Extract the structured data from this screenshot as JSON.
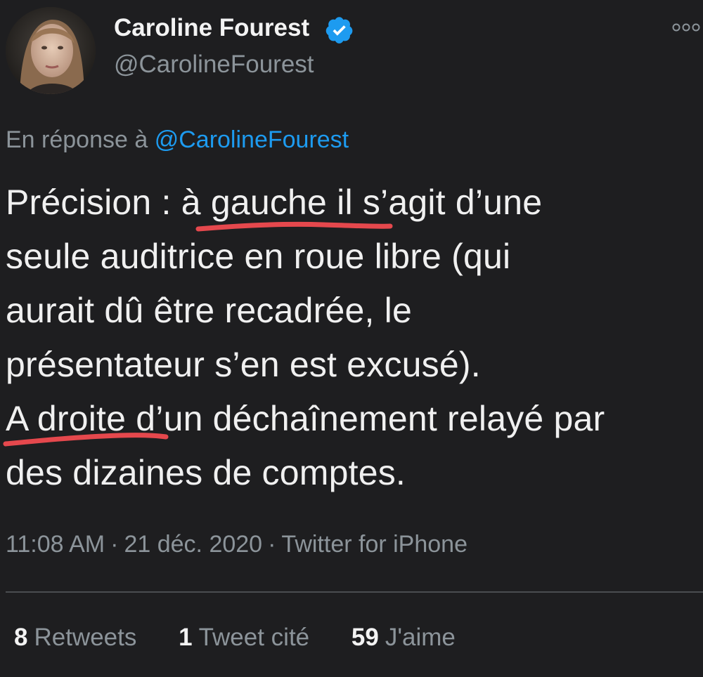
{
  "author": {
    "name": "Caroline Fourest",
    "handle": "@CarolineFourest",
    "verified_color": "#1d9bf0",
    "verified_icon": "verified-badge-icon",
    "avatar_icon": "profile-avatar"
  },
  "more_icon": "more-options-icon",
  "reply_to": {
    "prefix": "En réponse à",
    "mention": "@CarolineFourest"
  },
  "tweet": {
    "lines": [
      "Précision : à gauche il s’agit d’une",
      "seule auditrice en roue libre (qui",
      "aurait dû être recadrée, le",
      "présentateur s’en est excusé).",
      "A droite d’un déchaînement relayé par",
      "des dizaines de comptes."
    ],
    "annotation_color": "#e5484d"
  },
  "meta": {
    "time": "11:08 AM",
    "date": "21 déc. 2020",
    "separator": "·",
    "source": "Twitter for iPhone"
  },
  "stats": {
    "retweets": {
      "count": "8",
      "label": "Retweets"
    },
    "quotes": {
      "count": "1",
      "label": "Tweet cité"
    },
    "likes": {
      "count": "59",
      "label": "J'aime"
    }
  }
}
